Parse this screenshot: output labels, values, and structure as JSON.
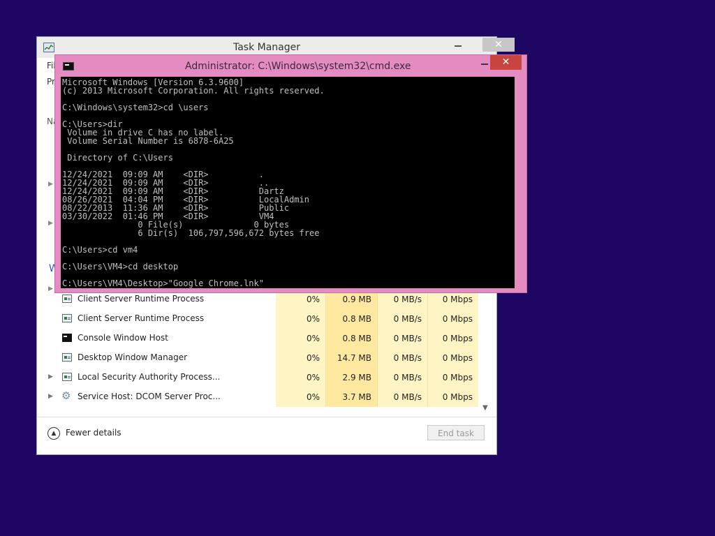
{
  "task_manager": {
    "title": "Task Manager",
    "close_glyph": "✕",
    "menu_partial": "Fil",
    "tab_partial": "Pr",
    "name_header_partial": "Na",
    "section_partial": "W",
    "processes": [
      {
        "name": "Client Server Runtime Process",
        "cpu": "0%",
        "memory": "0.9 MB",
        "disk": "0 MB/s",
        "network": "0 Mbps",
        "expandable": false,
        "icon": "process-window-icon"
      },
      {
        "name": "Client Server Runtime Process",
        "cpu": "0%",
        "memory": "0.8 MB",
        "disk": "0 MB/s",
        "network": "0 Mbps",
        "expandable": false,
        "icon": "process-window-icon"
      },
      {
        "name": "Console Window Host",
        "cpu": "0%",
        "memory": "0.8 MB",
        "disk": "0 MB/s",
        "network": "0 Mbps",
        "expandable": false,
        "icon": "console-icon"
      },
      {
        "name": "Desktop Window Manager",
        "cpu": "0%",
        "memory": "14.7 MB",
        "disk": "0 MB/s",
        "network": "0 Mbps",
        "expandable": false,
        "icon": "process-window-icon"
      },
      {
        "name": "Local Security Authority Process...",
        "cpu": "0%",
        "memory": "2.9 MB",
        "disk": "0 MB/s",
        "network": "0 Mbps",
        "expandable": true,
        "icon": "process-window-icon"
      },
      {
        "name": "Service Host: DCOM Server Proc...",
        "cpu": "0%",
        "memory": "3.7 MB",
        "disk": "0 MB/s",
        "network": "0 Mbps",
        "expandable": true,
        "icon": "gear-icon"
      }
    ],
    "footer": {
      "fewer_details_label": "Fewer details",
      "end_task_label": "End task"
    }
  },
  "cmd": {
    "title": "Administrator: C:\\Windows\\system32\\cmd.exe",
    "close_glyph": "✕",
    "lines": [
      "Microsoft Windows [Version 6.3.9600]",
      "(c) 2013 Microsoft Corporation. All rights reserved.",
      "",
      "C:\\Windows\\system32>cd \\users",
      "",
      "C:\\Users>dir",
      " Volume in drive C has no label.",
      " Volume Serial Number is 6878-6A25",
      "",
      " Directory of C:\\Users",
      "",
      "12/24/2021  09:09 AM    <DIR>          .",
      "12/24/2021  09:09 AM    <DIR>          ..",
      "12/24/2021  09:09 AM    <DIR>          Dartz",
      "08/26/2021  04:04 PM    <DIR>          LocalAdmin",
      "08/22/2013  11:36 AM    <DIR>          Public",
      "03/30/2022  01:46 PM    <DIR>          VM4",
      "               0 File(s)              0 bytes",
      "               6 Dir(s)  106,797,596,672 bytes free",
      "",
      "C:\\Users>cd vm4",
      "",
      "C:\\Users\\VM4>cd desktop",
      "",
      "C:\\Users\\VM4\\Desktop>\"Google Chrome.lnk\""
    ]
  },
  "colors": {
    "desktop": "#1d0763",
    "cmd_frame": "#e48cc2",
    "cmd_close": "#c7443f"
  }
}
